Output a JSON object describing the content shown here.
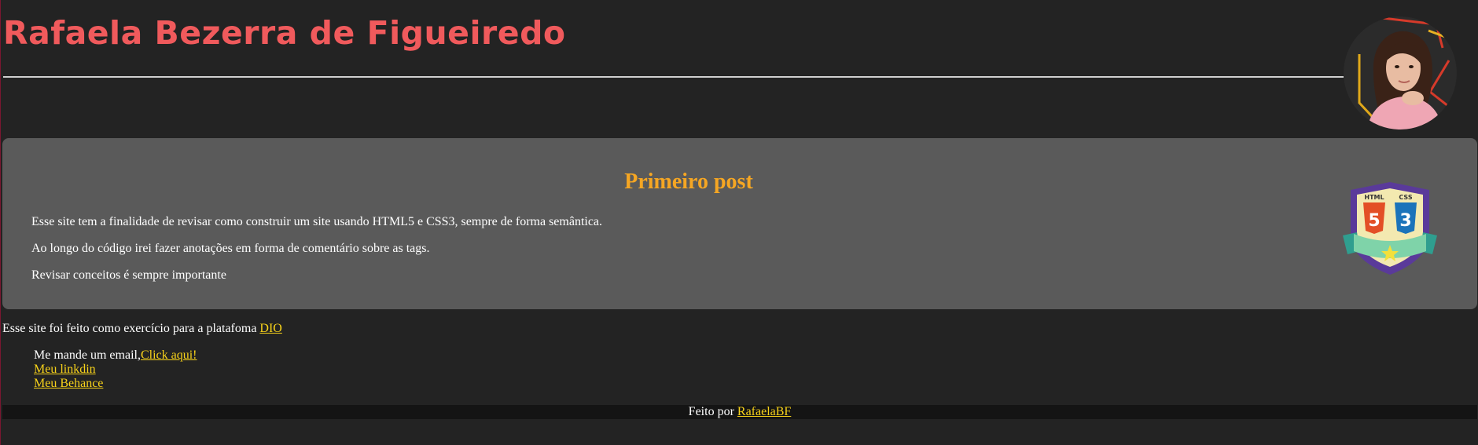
{
  "header": {
    "title": "Rafaela Bezerra de Figueiredo"
  },
  "post": {
    "title": "Primeiro post",
    "paragraphs": [
      "Esse site tem a finalidade de revisar como construir um site usando HTML5 e CSS3, sempre de forma semântica.",
      "Ao longo do código irei fazer anotações em forma de comentário sobre as tags.",
      "Revisar conceitos é sempre importante"
    ],
    "badge": {
      "html_label": "HTML",
      "css_label": "CSS",
      "html_number": "5",
      "css_number": "3"
    }
  },
  "credit": {
    "text": "Esse site foi feito como exercício para a platafoma ",
    "link": "DIO"
  },
  "contact": {
    "email_text": "Me mande um email,",
    "email_link": "Click aqui!",
    "linkedin": "Meu linkdin",
    "behance": "Meu Behance"
  },
  "footer": {
    "text": "Feito por ",
    "link": "RafaelaBF"
  },
  "colors": {
    "background": "#232323",
    "title": "#f05a5c",
    "post_bg": "#5a5a5a",
    "post_title": "#f5a623",
    "link": "#f7d21a",
    "footer_bg": "#141414"
  }
}
